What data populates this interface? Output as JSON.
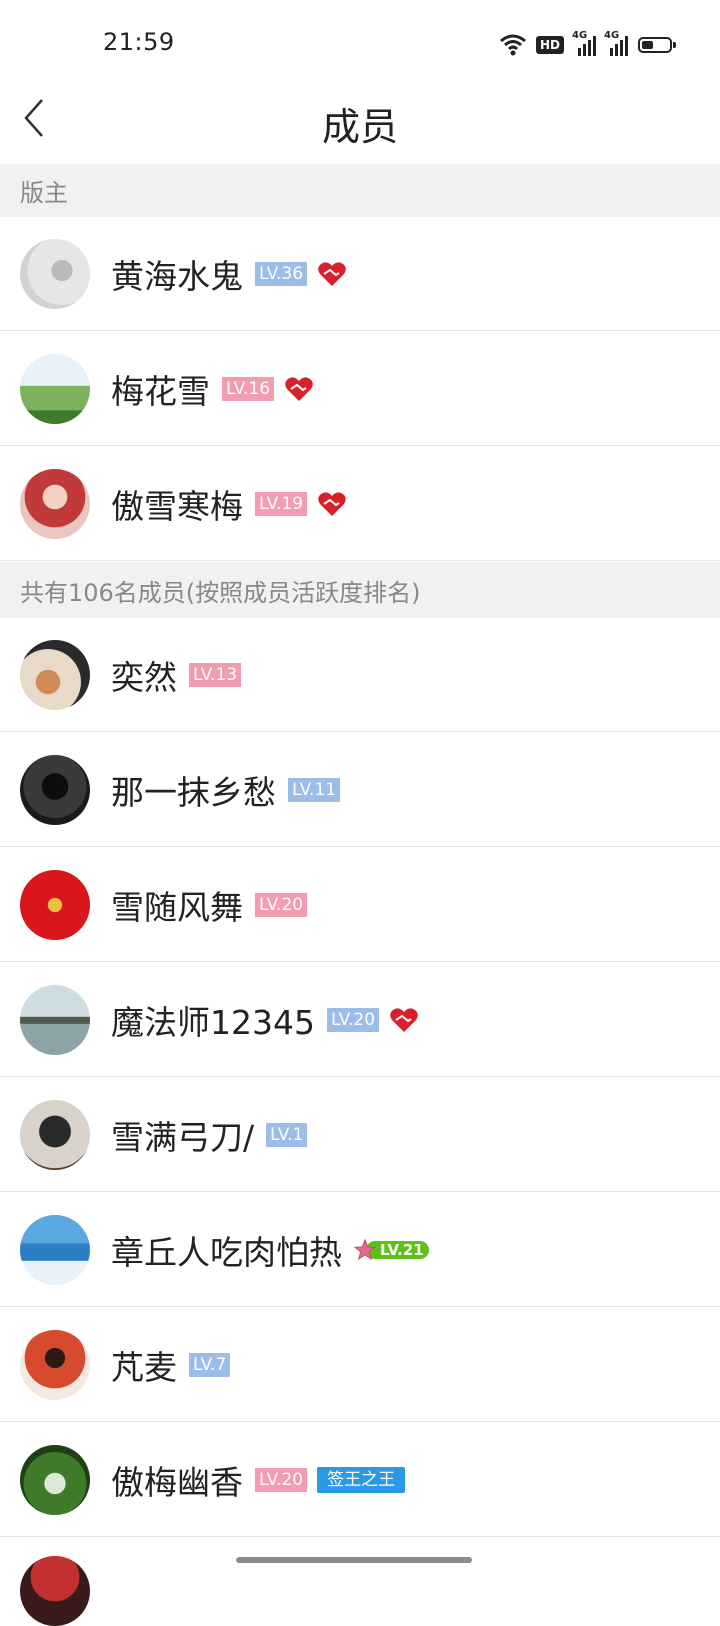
{
  "status_bar": {
    "time": "21:59",
    "hd_label": "HD",
    "network_1": "4G",
    "network_2": "4G",
    "battery_level": 0.45
  },
  "nav": {
    "title": "成员",
    "back_icon": "chevron-left-icon"
  },
  "sections": {
    "moderators_header": "版主",
    "members_header": "共有106名成员(按照成员活跃度排名)"
  },
  "moderators": [
    {
      "name": "黄海水鬼",
      "level": "LV.36",
      "level_color": "#9bbde8",
      "heart": true
    },
    {
      "name": "梅花雪",
      "level": "LV.16",
      "level_color": "#f29cb1",
      "heart": true
    },
    {
      "name": "傲雪寒梅",
      "level": "LV.19",
      "level_color": "#f29cb1",
      "heart": true
    }
  ],
  "members": [
    {
      "name": "奕然",
      "level": "LV.13",
      "level_color": "#f29cb1"
    },
    {
      "name": "那一抹乡愁",
      "level": "LV.11",
      "level_color": "#9bbde8"
    },
    {
      "name": "雪随风舞",
      "level": "LV.20",
      "level_color": "#f29cb1"
    },
    {
      "name": "魔法师12345",
      "level": "LV.20",
      "level_color": "#9bbde8",
      "heart": true
    },
    {
      "name": "雪满弓刀/",
      "level": "LV.1",
      "level_color": "#9bbde8"
    },
    {
      "name": "章丘人吃肉怕热",
      "level": "LV.21",
      "level_color": "#5cc21a"
    },
    {
      "name": "芃麦",
      "level": "LV.7",
      "level_color": "#9bbde8"
    },
    {
      "name": "傲梅幽香",
      "level": "LV.20",
      "level_color": "#f29cb1",
      "tag": "签王之王"
    }
  ],
  "colors": {
    "section_bg": "#f1f1f1",
    "heart": "#d9202a",
    "tag_blue": "#2a9ae6"
  }
}
